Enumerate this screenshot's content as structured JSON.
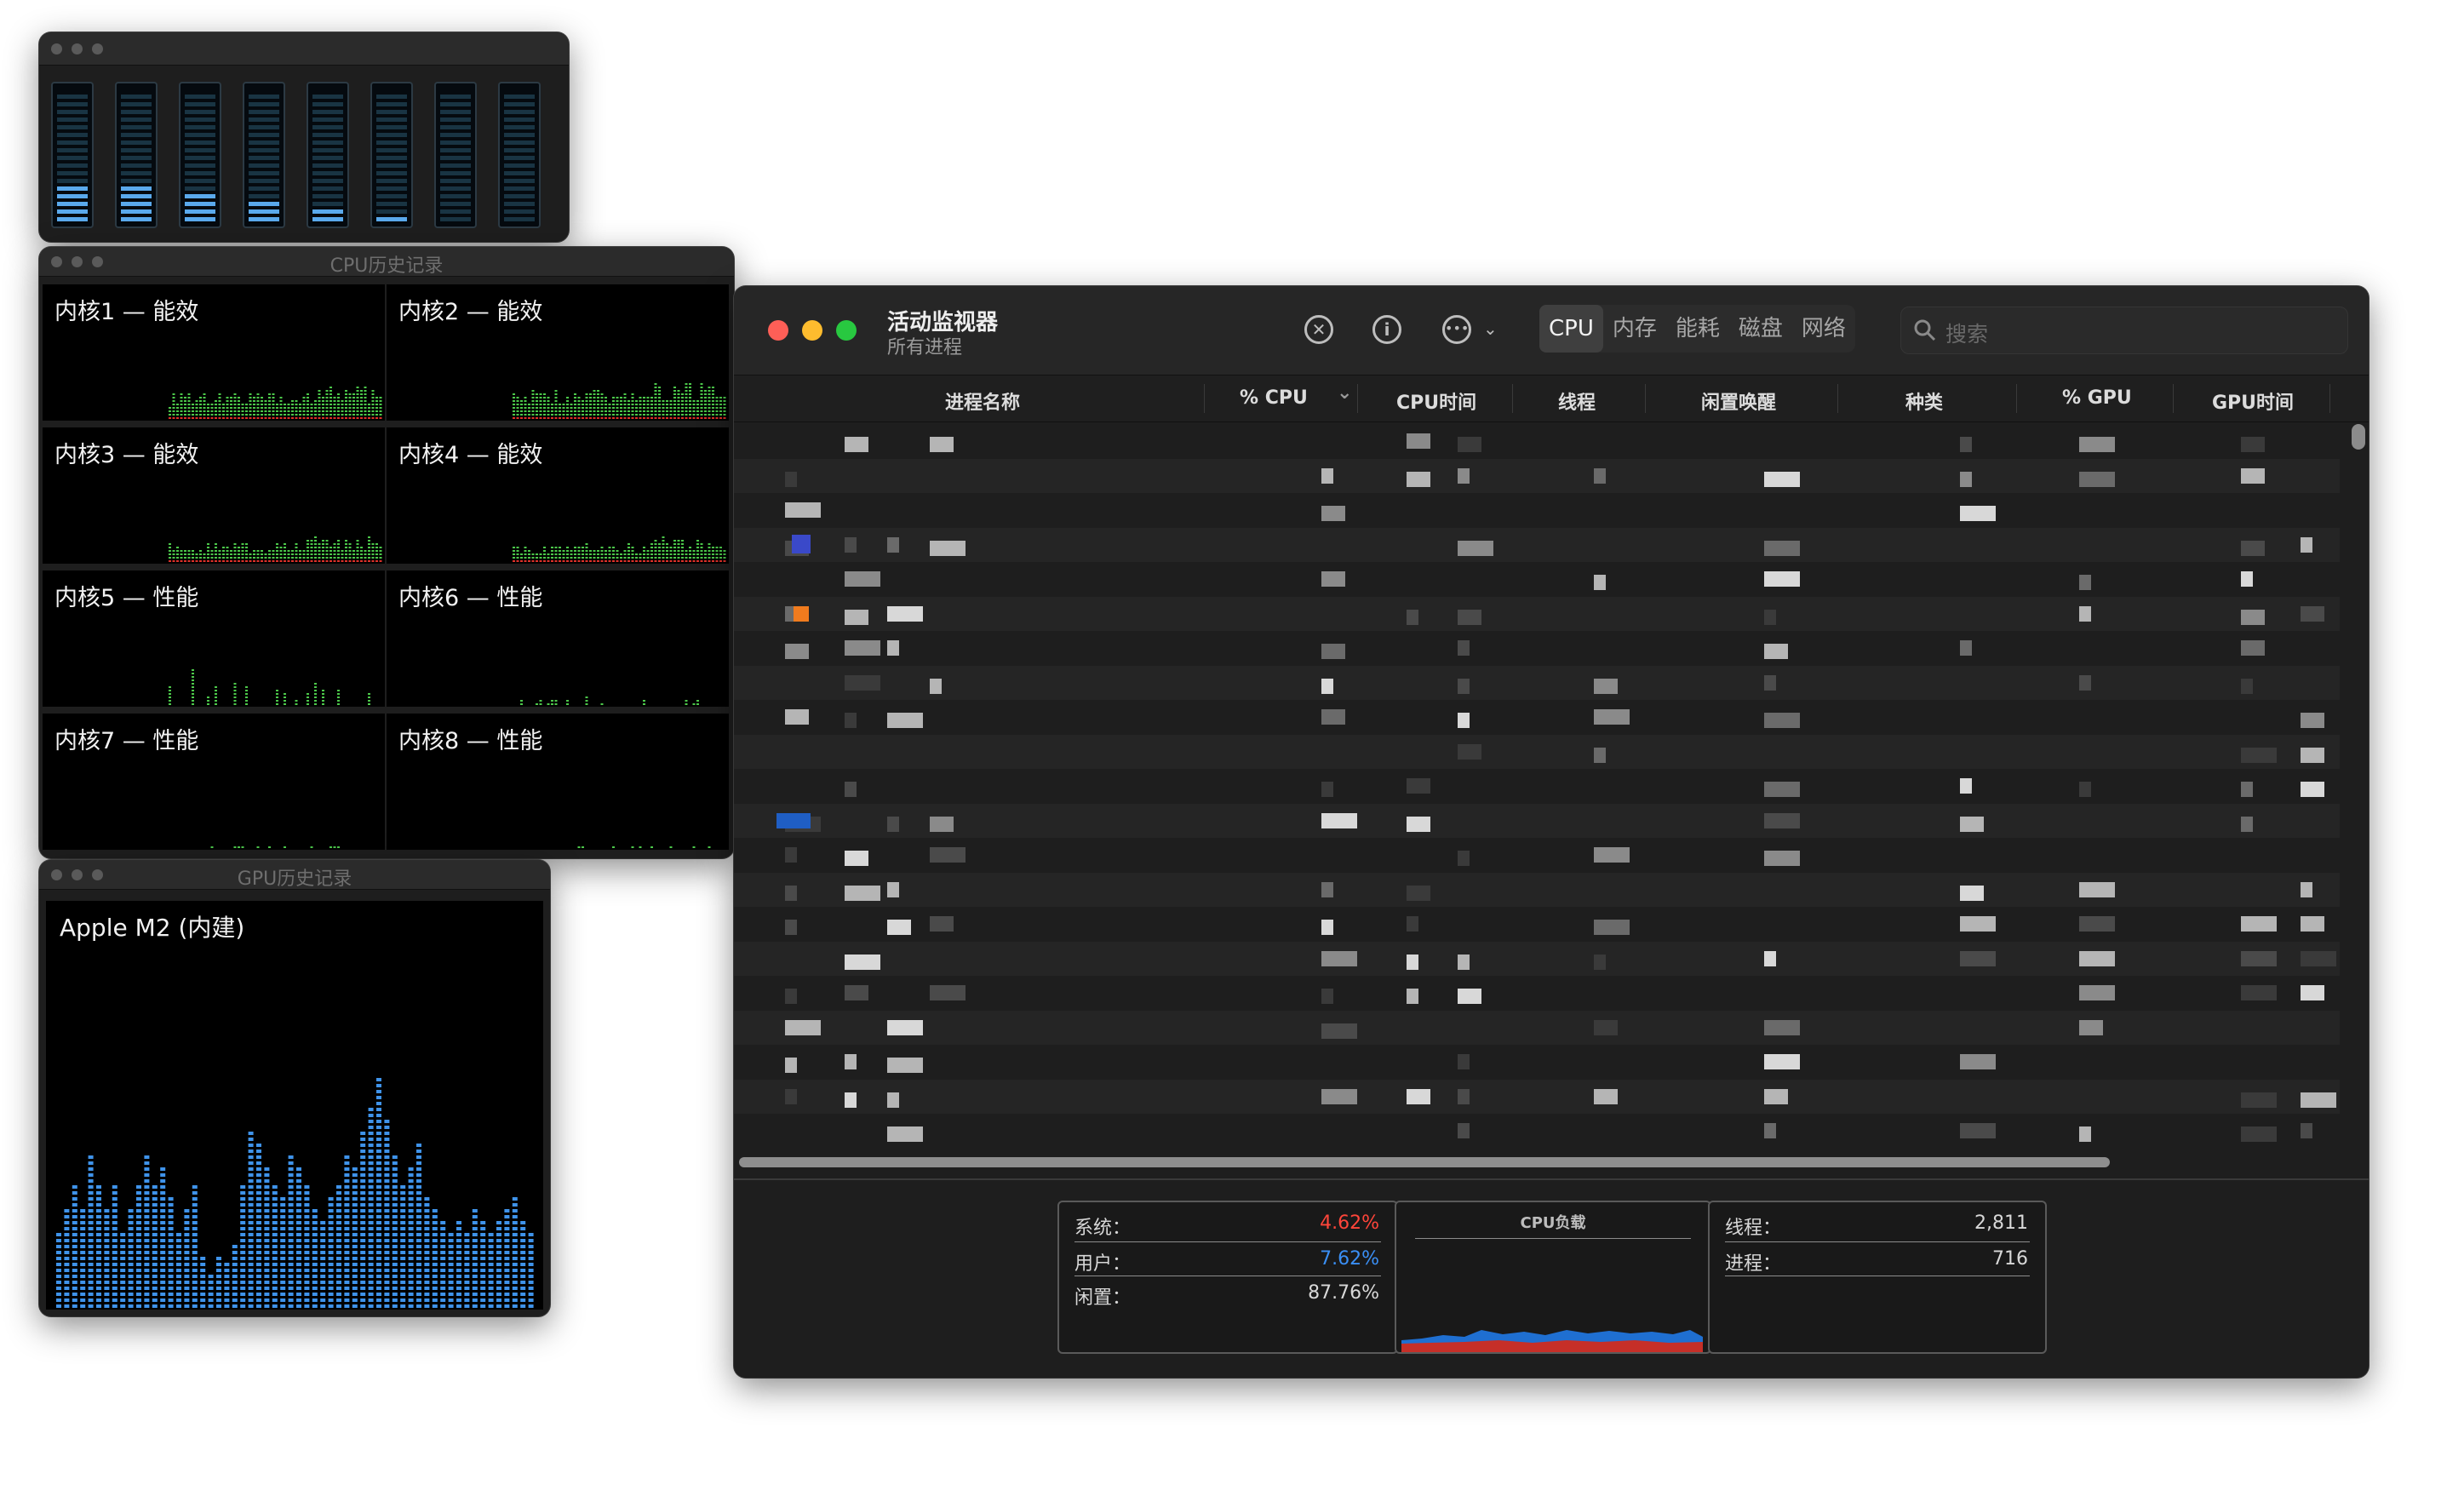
{
  "cpu_usage_window": {
    "levels": [
      0.3,
      0.3,
      0.25,
      0.18,
      0.1,
      0.05,
      0,
      0
    ]
  },
  "cpu_history": {
    "title": "CPU历史记录",
    "cores": [
      {
        "label": "内核1 — 能效"
      },
      {
        "label": "内核2 — 能效"
      },
      {
        "label": "内核3 — 能效"
      },
      {
        "label": "内核4 — 能效"
      },
      {
        "label": "内核5 — 性能"
      },
      {
        "label": "内核6 — 性能"
      },
      {
        "label": "内核7 — 性能"
      },
      {
        "label": "内核8 — 性能"
      }
    ]
  },
  "gpu_history": {
    "title": "GPU历史记录",
    "gpu_name": "Apple M2 (内建)",
    "levels": [
      0.3,
      0.4,
      0.5,
      0.4,
      0.6,
      0.5,
      0.4,
      0.5,
      0.3,
      0.4,
      0.5,
      0.6,
      0.5,
      0.55,
      0.45,
      0.3,
      0.4,
      0.5,
      0.2,
      0.15,
      0.2,
      0.18,
      0.25,
      0.5,
      0.7,
      0.65,
      0.55,
      0.5,
      0.45,
      0.6,
      0.55,
      0.5,
      0.4,
      0.35,
      0.45,
      0.5,
      0.6,
      0.55,
      0.7,
      0.8,
      0.9,
      0.75,
      0.6,
      0.5,
      0.55,
      0.65,
      0.45,
      0.4,
      0.35,
      0.3,
      0.35,
      0.3,
      0.4,
      0.35,
      0.3,
      0.35,
      0.4,
      0.45,
      0.35,
      0.3
    ]
  },
  "activity_monitor": {
    "title": "活动监视器",
    "subtitle": "所有进程",
    "tabs": [
      "CPU",
      "内存",
      "能耗",
      "磁盘",
      "网络"
    ],
    "selected_tab": "CPU",
    "search_placeholder": "搜索",
    "columns": [
      "进程名称",
      "% CPU",
      "CPU时间",
      "线程",
      "闲置唤醒",
      "种类",
      "% GPU",
      "GPU时间"
    ],
    "sorted_column": "% CPU",
    "footer": {
      "system_label": "系统：",
      "system_value": "4.62%",
      "user_label": "用户：",
      "user_value": "7.62%",
      "idle_label": "闲置：",
      "idle_value": "87.76%",
      "cpu_load_label": "CPU负载",
      "threads_label": "线程：",
      "threads_value": "2,811",
      "processes_label": "进程：",
      "processes_value": "716",
      "colors": {
        "system": "#ff453a",
        "user": "#3a8ff5"
      }
    }
  }
}
